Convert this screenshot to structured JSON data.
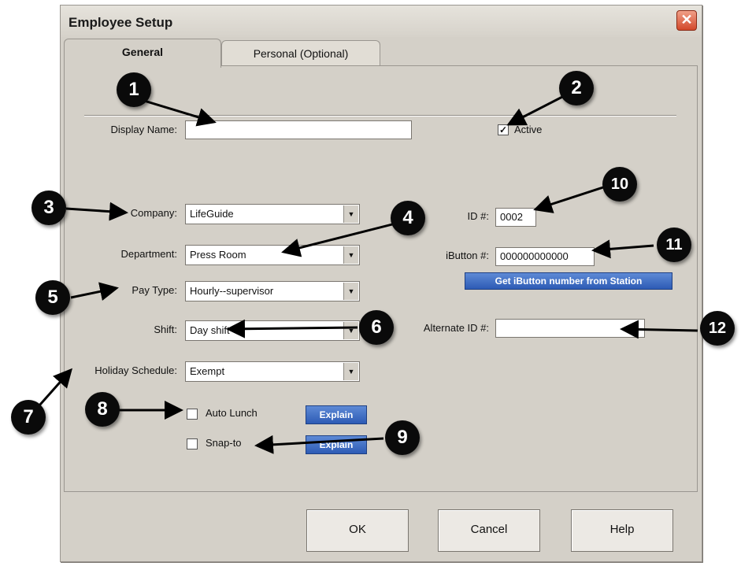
{
  "window": {
    "title": "Employee Setup",
    "close_symbol": "✕"
  },
  "tabs": [
    {
      "label": "General",
      "active": true
    },
    {
      "label": "Personal (Optional)",
      "active": false
    }
  ],
  "display_name": {
    "label": "Display Name:",
    "value": ""
  },
  "active": {
    "label": "Active",
    "checked": true,
    "mark": "✓"
  },
  "company": {
    "label": "Company:",
    "value": "LifeGuide"
  },
  "department": {
    "label": "Department:",
    "value": "Press Room"
  },
  "pay_type": {
    "label": "Pay Type:",
    "value": "Hourly--supervisor"
  },
  "shift": {
    "label": "Shift:",
    "value": "Day shift"
  },
  "holiday_schedule": {
    "label": "Holiday Schedule:",
    "value": "Exempt"
  },
  "auto_lunch": {
    "label": "Auto Lunch",
    "checked": false,
    "explain_label": "Explain"
  },
  "snap_to": {
    "label": "Snap-to",
    "checked": false,
    "explain_label": "Explain"
  },
  "id_field": {
    "label": "ID #:",
    "value": "0002"
  },
  "ibutton": {
    "label": "iButton #:",
    "value": "000000000000",
    "station_button": "Get iButton number from Station"
  },
  "alternate_id": {
    "label": "Alternate ID #:",
    "value": ""
  },
  "buttons": {
    "ok": "OK",
    "cancel": "Cancel",
    "help": "Help"
  },
  "dropdown_arrow": "▼",
  "callouts": [
    "1",
    "2",
    "3",
    "4",
    "5",
    "6",
    "7",
    "8",
    "9",
    "10",
    "11",
    "12"
  ]
}
